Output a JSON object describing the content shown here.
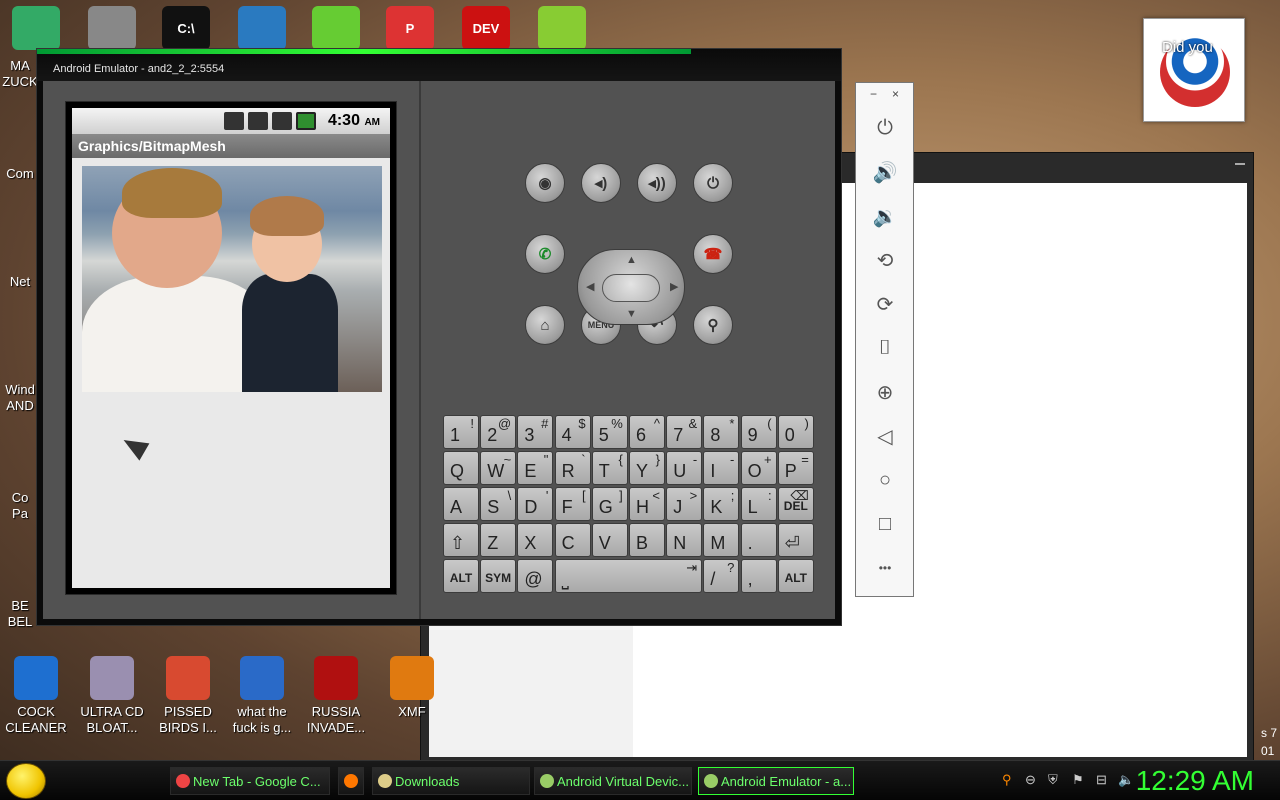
{
  "desktop": {
    "left_labels": [
      "MA\nZUCK",
      "Com",
      "Net",
      "Wind\nAND",
      "Co\nPa",
      "BE\nBEL"
    ],
    "bottom_icons": [
      {
        "label": "COCK\nCLEANER",
        "icon": "document-blue-icon",
        "color": "#1e6fd0"
      },
      {
        "label": "ULTRA CD\nBLOAT...",
        "icon": "cd-icon",
        "color": "#9a8fb0"
      },
      {
        "label": "PISSED\nBIRDS I...",
        "icon": "birds-game-icon",
        "color": "#d84a30"
      },
      {
        "label": "what the\nfuck is g...",
        "icon": "angry-birds-space-icon",
        "color": "#2a6ac8"
      },
      {
        "label": "RUSSIA\nINVADE...",
        "icon": "radiation-icon",
        "color": "#b01010"
      },
      {
        "label": "XMF",
        "icon": "xmf-icon",
        "color": "#e07a10"
      }
    ],
    "top_icons": [
      {
        "icon": "app-icon",
        "color": "#3a6"
      },
      {
        "icon": "papers-icon",
        "color": "#888"
      },
      {
        "icon": "terminal-icon",
        "color": "#111",
        "text": "C:\\"
      },
      {
        "icon": "paint-icon",
        "color": "#2a7ac0"
      },
      {
        "icon": "bad-piggies-icon",
        "color": "#6c3"
      },
      {
        "icon": "p-icon",
        "color": "#d33",
        "text": "P"
      },
      {
        "icon": "dev-cpp-icon",
        "color": "#c11",
        "text": "DEV"
      },
      {
        "icon": "android-icon",
        "color": "#8c3"
      }
    ],
    "poster_text": "Did you",
    "right_edge_text": [
      "s 7",
      "01"
    ]
  },
  "emulator": {
    "title": "Android Emulator - and2_2_2:5554",
    "status_time": "4:30",
    "status_ampm": "AM",
    "app_title": "Graphics/BitmapMesh",
    "buttons_row1": [
      {
        "name": "camera-button",
        "glyph": "◉"
      },
      {
        "name": "volume-down-button",
        "glyph": "◂)"
      },
      {
        "name": "volume-up-button",
        "glyph": "◂))"
      },
      {
        "name": "power-button",
        "glyph": "⏻"
      }
    ],
    "call_glyph": "✆",
    "endcall_glyph": "☎",
    "buttons_row3": [
      {
        "name": "home-button",
        "glyph": "⌂"
      },
      {
        "name": "menu-button",
        "glyph": "MENU"
      },
      {
        "name": "back-button",
        "glyph": "↶"
      },
      {
        "name": "search-button",
        "glyph": "⚲"
      }
    ],
    "keyboard": [
      [
        [
          "1",
          "!"
        ],
        [
          "2",
          "@"
        ],
        [
          "3",
          "#"
        ],
        [
          "4",
          "$"
        ],
        [
          "5",
          "%"
        ],
        [
          "6",
          "^"
        ],
        [
          "7",
          "&"
        ],
        [
          "8",
          "*"
        ],
        [
          "9",
          "("
        ],
        [
          "0",
          ")"
        ]
      ],
      [
        [
          "Q",
          ""
        ],
        [
          "W",
          "~"
        ],
        [
          "E",
          "\""
        ],
        [
          "R",
          "`"
        ],
        [
          "T",
          "{"
        ],
        [
          "Y",
          "}"
        ],
        [
          "U",
          "-"
        ],
        [
          "I",
          "-"
        ],
        [
          "O",
          "+"
        ],
        [
          "P",
          "="
        ]
      ],
      [
        [
          "A",
          ""
        ],
        [
          "S",
          "\\"
        ],
        [
          "D",
          "'"
        ],
        [
          "F",
          "["
        ],
        [
          "G",
          "]"
        ],
        [
          "H",
          "<"
        ],
        [
          "J",
          ">"
        ],
        [
          "K",
          ";"
        ],
        [
          "L",
          ":"
        ],
        [
          "DEL",
          "⌫"
        ]
      ],
      [
        [
          "⇧",
          ""
        ],
        [
          "Z",
          ""
        ],
        [
          "X",
          ""
        ],
        [
          "C",
          ""
        ],
        [
          "V",
          ""
        ],
        [
          "B",
          ""
        ],
        [
          "N",
          ""
        ],
        [
          "M",
          ""
        ],
        [
          ".",
          ""
        ],
        [
          "⏎",
          ""
        ]
      ],
      [
        [
          "ALT",
          ""
        ],
        [
          "SYM",
          ""
        ],
        [
          "@",
          ""
        ],
        [
          "␣",
          "⇥"
        ],
        [
          "/",
          "?"
        ],
        [
          ",",
          ""
        ],
        [
          "ALT",
          ""
        ]
      ]
    ]
  },
  "sidebar": {
    "minimize": "−",
    "close": "×",
    "items": [
      {
        "name": "power-icon",
        "glyph": "⏻"
      },
      {
        "name": "volume-up-icon",
        "glyph": "🔊"
      },
      {
        "name": "volume-down-icon",
        "glyph": "🔉"
      },
      {
        "name": "rotate-left-icon",
        "glyph": "⟲"
      },
      {
        "name": "rotate-right-icon",
        "glyph": "⟳"
      },
      {
        "name": "screenshot-icon",
        "glyph": "⌷"
      },
      {
        "name": "zoom-icon",
        "glyph": "⊕"
      },
      {
        "name": "back-icon",
        "glyph": "◁"
      },
      {
        "name": "home-icon",
        "glyph": "○"
      },
      {
        "name": "overview-icon",
        "glyph": "□"
      },
      {
        "name": "more-icon",
        "glyph": "•••"
      }
    ]
  },
  "taskbar": {
    "buttons": [
      {
        "label": "New Tab - Google C...",
        "icon": "chrome-icon",
        "color": "#e44"
      },
      {
        "label": "",
        "icon": "firefox-icon",
        "color": "#f70"
      },
      {
        "label": "Downloads",
        "icon": "folder-icon",
        "color": "#dc8"
      },
      {
        "label": "Android Virtual Devic...",
        "icon": "avd-icon",
        "color": "#9c6"
      },
      {
        "label": "Android Emulator - a...",
        "icon": "emulator-icon",
        "color": "#9c6"
      }
    ],
    "clock": "12:29 AM"
  }
}
